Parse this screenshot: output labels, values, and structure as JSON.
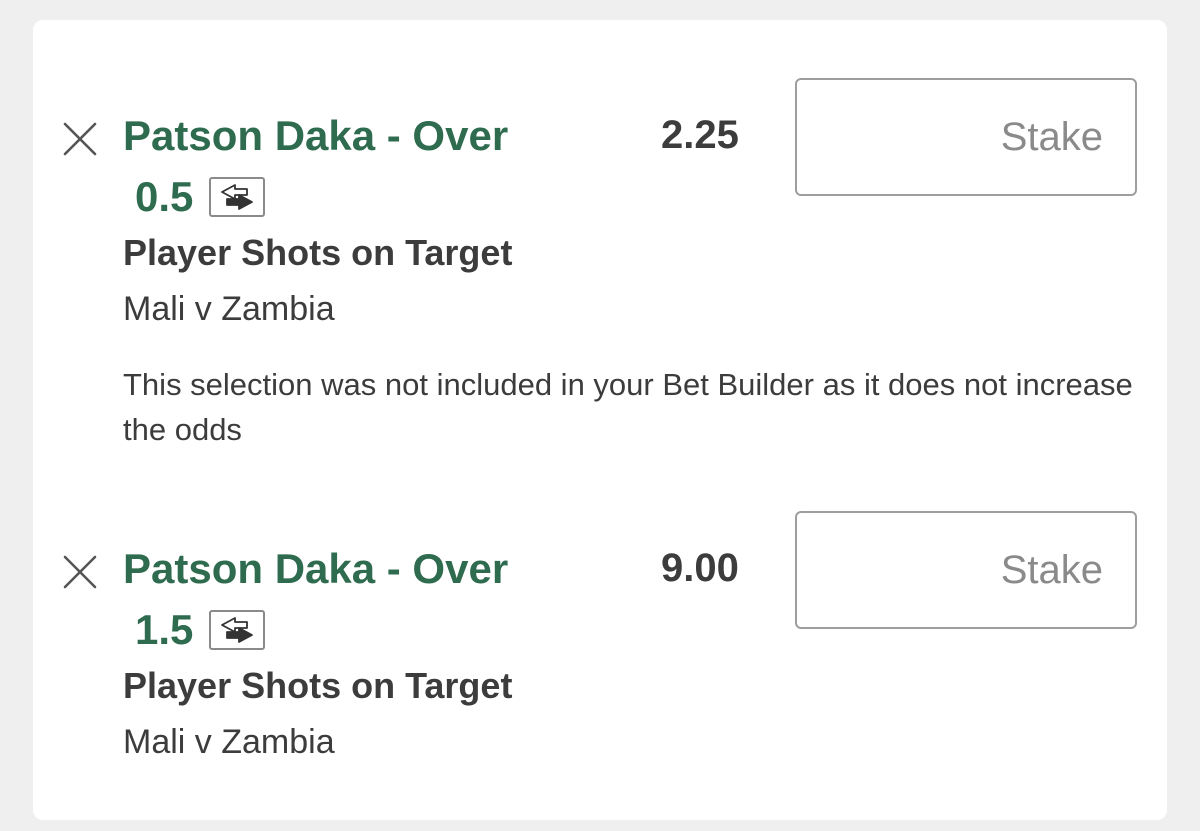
{
  "selections": [
    {
      "title_line1": "Patson Daka - Over",
      "title_line2": "0.5",
      "odds": "2.25",
      "market": "Player Shots on Target",
      "event": "Mali v Zambia",
      "stake_placeholder": "Stake",
      "stake_value": "",
      "notice": "This selection was not included in your Bet Builder as it does not increase the odds",
      "remove_icon": "close-icon",
      "swap_icon": "swap-arrows-icon"
    },
    {
      "title_line1": "Patson Daka - Over",
      "title_line2": "1.5",
      "odds": "9.00",
      "market": "Player Shots on Target",
      "event": "Mali v Zambia",
      "stake_placeholder": "Stake",
      "stake_value": "",
      "remove_icon": "close-icon",
      "swap_icon": "swap-arrows-icon"
    }
  ],
  "colors": {
    "selection_title": "#2e6b4f",
    "text": "#3c3c3c",
    "background": "#efefef",
    "card": "#ffffff"
  }
}
